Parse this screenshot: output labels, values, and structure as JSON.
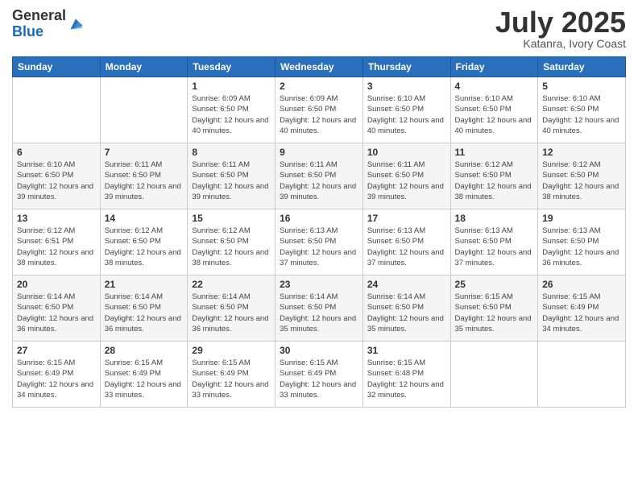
{
  "logo": {
    "general": "General",
    "blue": "Blue"
  },
  "header": {
    "month": "July 2025",
    "location": "Katanra, Ivory Coast"
  },
  "weekdays": [
    "Sunday",
    "Monday",
    "Tuesday",
    "Wednesday",
    "Thursday",
    "Friday",
    "Saturday"
  ],
  "weeks": [
    [
      {
        "day": "",
        "sunrise": "",
        "sunset": "",
        "daylight": ""
      },
      {
        "day": "",
        "sunrise": "",
        "sunset": "",
        "daylight": ""
      },
      {
        "day": "1",
        "sunrise": "Sunrise: 6:09 AM",
        "sunset": "Sunset: 6:50 PM",
        "daylight": "Daylight: 12 hours and 40 minutes."
      },
      {
        "day": "2",
        "sunrise": "Sunrise: 6:09 AM",
        "sunset": "Sunset: 6:50 PM",
        "daylight": "Daylight: 12 hours and 40 minutes."
      },
      {
        "day": "3",
        "sunrise": "Sunrise: 6:10 AM",
        "sunset": "Sunset: 6:50 PM",
        "daylight": "Daylight: 12 hours and 40 minutes."
      },
      {
        "day": "4",
        "sunrise": "Sunrise: 6:10 AM",
        "sunset": "Sunset: 6:50 PM",
        "daylight": "Daylight: 12 hours and 40 minutes."
      },
      {
        "day": "5",
        "sunrise": "Sunrise: 6:10 AM",
        "sunset": "Sunset: 6:50 PM",
        "daylight": "Daylight: 12 hours and 40 minutes."
      }
    ],
    [
      {
        "day": "6",
        "sunrise": "Sunrise: 6:10 AM",
        "sunset": "Sunset: 6:50 PM",
        "daylight": "Daylight: 12 hours and 39 minutes."
      },
      {
        "day": "7",
        "sunrise": "Sunrise: 6:11 AM",
        "sunset": "Sunset: 6:50 PM",
        "daylight": "Daylight: 12 hours and 39 minutes."
      },
      {
        "day": "8",
        "sunrise": "Sunrise: 6:11 AM",
        "sunset": "Sunset: 6:50 PM",
        "daylight": "Daylight: 12 hours and 39 minutes."
      },
      {
        "day": "9",
        "sunrise": "Sunrise: 6:11 AM",
        "sunset": "Sunset: 6:50 PM",
        "daylight": "Daylight: 12 hours and 39 minutes."
      },
      {
        "day": "10",
        "sunrise": "Sunrise: 6:11 AM",
        "sunset": "Sunset: 6:50 PM",
        "daylight": "Daylight: 12 hours and 39 minutes."
      },
      {
        "day": "11",
        "sunrise": "Sunrise: 6:12 AM",
        "sunset": "Sunset: 6:50 PM",
        "daylight": "Daylight: 12 hours and 38 minutes."
      },
      {
        "day": "12",
        "sunrise": "Sunrise: 6:12 AM",
        "sunset": "Sunset: 6:50 PM",
        "daylight": "Daylight: 12 hours and 38 minutes."
      }
    ],
    [
      {
        "day": "13",
        "sunrise": "Sunrise: 6:12 AM",
        "sunset": "Sunset: 6:51 PM",
        "daylight": "Daylight: 12 hours and 38 minutes."
      },
      {
        "day": "14",
        "sunrise": "Sunrise: 6:12 AM",
        "sunset": "Sunset: 6:50 PM",
        "daylight": "Daylight: 12 hours and 38 minutes."
      },
      {
        "day": "15",
        "sunrise": "Sunrise: 6:12 AM",
        "sunset": "Sunset: 6:50 PM",
        "daylight": "Daylight: 12 hours and 38 minutes."
      },
      {
        "day": "16",
        "sunrise": "Sunrise: 6:13 AM",
        "sunset": "Sunset: 6:50 PM",
        "daylight": "Daylight: 12 hours and 37 minutes."
      },
      {
        "day": "17",
        "sunrise": "Sunrise: 6:13 AM",
        "sunset": "Sunset: 6:50 PM",
        "daylight": "Daylight: 12 hours and 37 minutes."
      },
      {
        "day": "18",
        "sunrise": "Sunrise: 6:13 AM",
        "sunset": "Sunset: 6:50 PM",
        "daylight": "Daylight: 12 hours and 37 minutes."
      },
      {
        "day": "19",
        "sunrise": "Sunrise: 6:13 AM",
        "sunset": "Sunset: 6:50 PM",
        "daylight": "Daylight: 12 hours and 36 minutes."
      }
    ],
    [
      {
        "day": "20",
        "sunrise": "Sunrise: 6:14 AM",
        "sunset": "Sunset: 6:50 PM",
        "daylight": "Daylight: 12 hours and 36 minutes."
      },
      {
        "day": "21",
        "sunrise": "Sunrise: 6:14 AM",
        "sunset": "Sunset: 6:50 PM",
        "daylight": "Daylight: 12 hours and 36 minutes."
      },
      {
        "day": "22",
        "sunrise": "Sunrise: 6:14 AM",
        "sunset": "Sunset: 6:50 PM",
        "daylight": "Daylight: 12 hours and 36 minutes."
      },
      {
        "day": "23",
        "sunrise": "Sunrise: 6:14 AM",
        "sunset": "Sunset: 6:50 PM",
        "daylight": "Daylight: 12 hours and 35 minutes."
      },
      {
        "day": "24",
        "sunrise": "Sunrise: 6:14 AM",
        "sunset": "Sunset: 6:50 PM",
        "daylight": "Daylight: 12 hours and 35 minutes."
      },
      {
        "day": "25",
        "sunrise": "Sunrise: 6:15 AM",
        "sunset": "Sunset: 6:50 PM",
        "daylight": "Daylight: 12 hours and 35 minutes."
      },
      {
        "day": "26",
        "sunrise": "Sunrise: 6:15 AM",
        "sunset": "Sunset: 6:49 PM",
        "daylight": "Daylight: 12 hours and 34 minutes."
      }
    ],
    [
      {
        "day": "27",
        "sunrise": "Sunrise: 6:15 AM",
        "sunset": "Sunset: 6:49 PM",
        "daylight": "Daylight: 12 hours and 34 minutes."
      },
      {
        "day": "28",
        "sunrise": "Sunrise: 6:15 AM",
        "sunset": "Sunset: 6:49 PM",
        "daylight": "Daylight: 12 hours and 33 minutes."
      },
      {
        "day": "29",
        "sunrise": "Sunrise: 6:15 AM",
        "sunset": "Sunset: 6:49 PM",
        "daylight": "Daylight: 12 hours and 33 minutes."
      },
      {
        "day": "30",
        "sunrise": "Sunrise: 6:15 AM",
        "sunset": "Sunset: 6:49 PM",
        "daylight": "Daylight: 12 hours and 33 minutes."
      },
      {
        "day": "31",
        "sunrise": "Sunrise: 6:15 AM",
        "sunset": "Sunset: 6:48 PM",
        "daylight": "Daylight: 12 hours and 32 minutes."
      },
      {
        "day": "",
        "sunrise": "",
        "sunset": "",
        "daylight": ""
      },
      {
        "day": "",
        "sunrise": "",
        "sunset": "",
        "daylight": ""
      }
    ]
  ]
}
